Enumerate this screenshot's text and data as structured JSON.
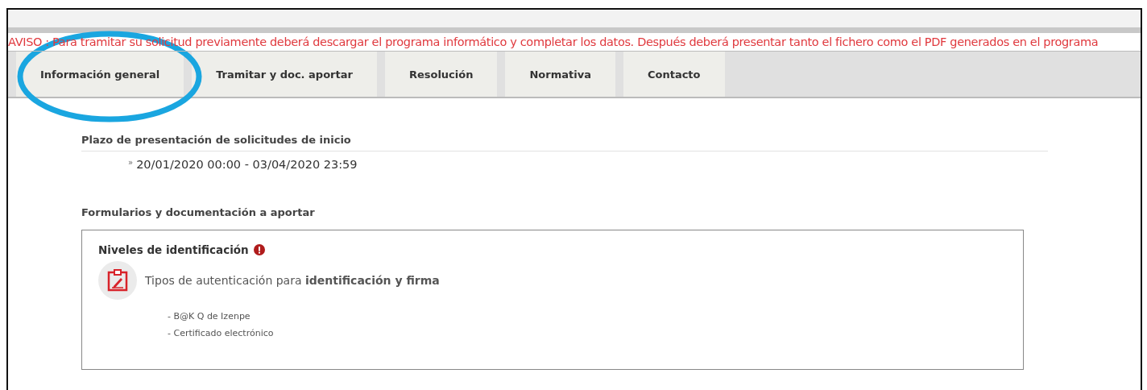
{
  "notice": "AVISO : Para tramitar su solicitud previamente deberá descargar el programa informático y completar los datos. Después deberá presentar tanto el fichero como el PDF generados en el programa",
  "tabs": [
    {
      "label": "Información general"
    },
    {
      "label": "Tramitar y doc. aportar"
    },
    {
      "label": "Resolución"
    },
    {
      "label": "Normativa"
    },
    {
      "label": "Contacto"
    }
  ],
  "deadline": {
    "heading": "Plazo de presentación de solicitudes de inicio",
    "marker": "»",
    "period": "20/01/2020 00:00 - 03/04/2020 23:59"
  },
  "documents": {
    "heading": "Formularios y documentación a aportar",
    "card": {
      "title": "Niveles de identificación",
      "text": "Tipos de autenticación para **identificación y firma**",
      "items": [
        "- B@K Q de Izenpe",
        "- Certificado electrónico"
      ]
    }
  }
}
